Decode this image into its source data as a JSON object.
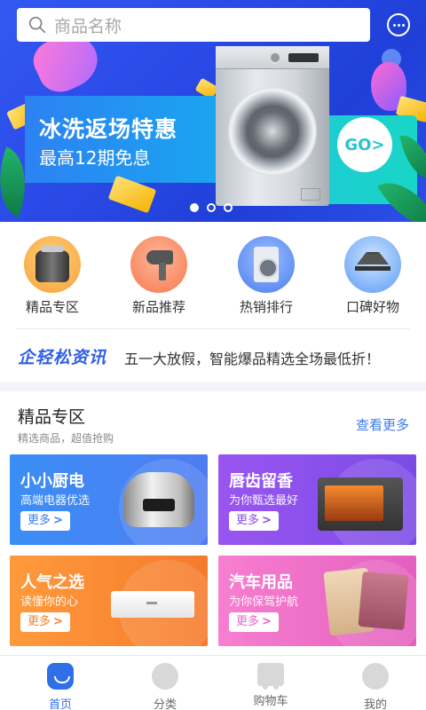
{
  "search": {
    "placeholder": "商品名称"
  },
  "banner": {
    "title": "冰洗返场特惠",
    "subtitle": "最高12期免息",
    "go_label": "GO>",
    "active_slide": 1,
    "slide_count": 3
  },
  "categories": [
    {
      "label": "精品专区",
      "icon": "rice-cooker-icon"
    },
    {
      "label": "新品推荐",
      "icon": "hair-dryer-icon"
    },
    {
      "label": "热销排行",
      "icon": "washing-machine-icon"
    },
    {
      "label": "口碑好物",
      "icon": "range-hood-icon"
    }
  ],
  "news": {
    "logo": "企轻松资讯",
    "text": "五一大放假，智能爆品精选全场最低折！"
  },
  "section": {
    "title": "精品专区",
    "subtitle": "精选商品，超值抢购",
    "see_more": "查看更多"
  },
  "products": [
    {
      "title": "小小厨电",
      "subtitle": "高端电器优选",
      "more": "更多",
      "color": "#3a8ef6"
    },
    {
      "title": "唇齿留香",
      "subtitle": "为你甄选最好",
      "more": "更多",
      "color": "#9a55f0"
    },
    {
      "title": "人气之选",
      "subtitle": "读懂你的心",
      "more": "更多",
      "color": "#ff9a3c"
    },
    {
      "title": "汽车用品",
      "subtitle": "为你保驾护航",
      "more": "更多",
      "color": "#f77fd0"
    }
  ],
  "tabs": [
    {
      "label": "首页",
      "active": true
    },
    {
      "label": "分类",
      "active": false
    },
    {
      "label": "购物车",
      "active": false
    },
    {
      "label": "我的",
      "active": false
    }
  ],
  "colors": {
    "accent": "#2f6fe8",
    "news_logo": "#2f5ee5",
    "see_more": "#3d7be8"
  }
}
